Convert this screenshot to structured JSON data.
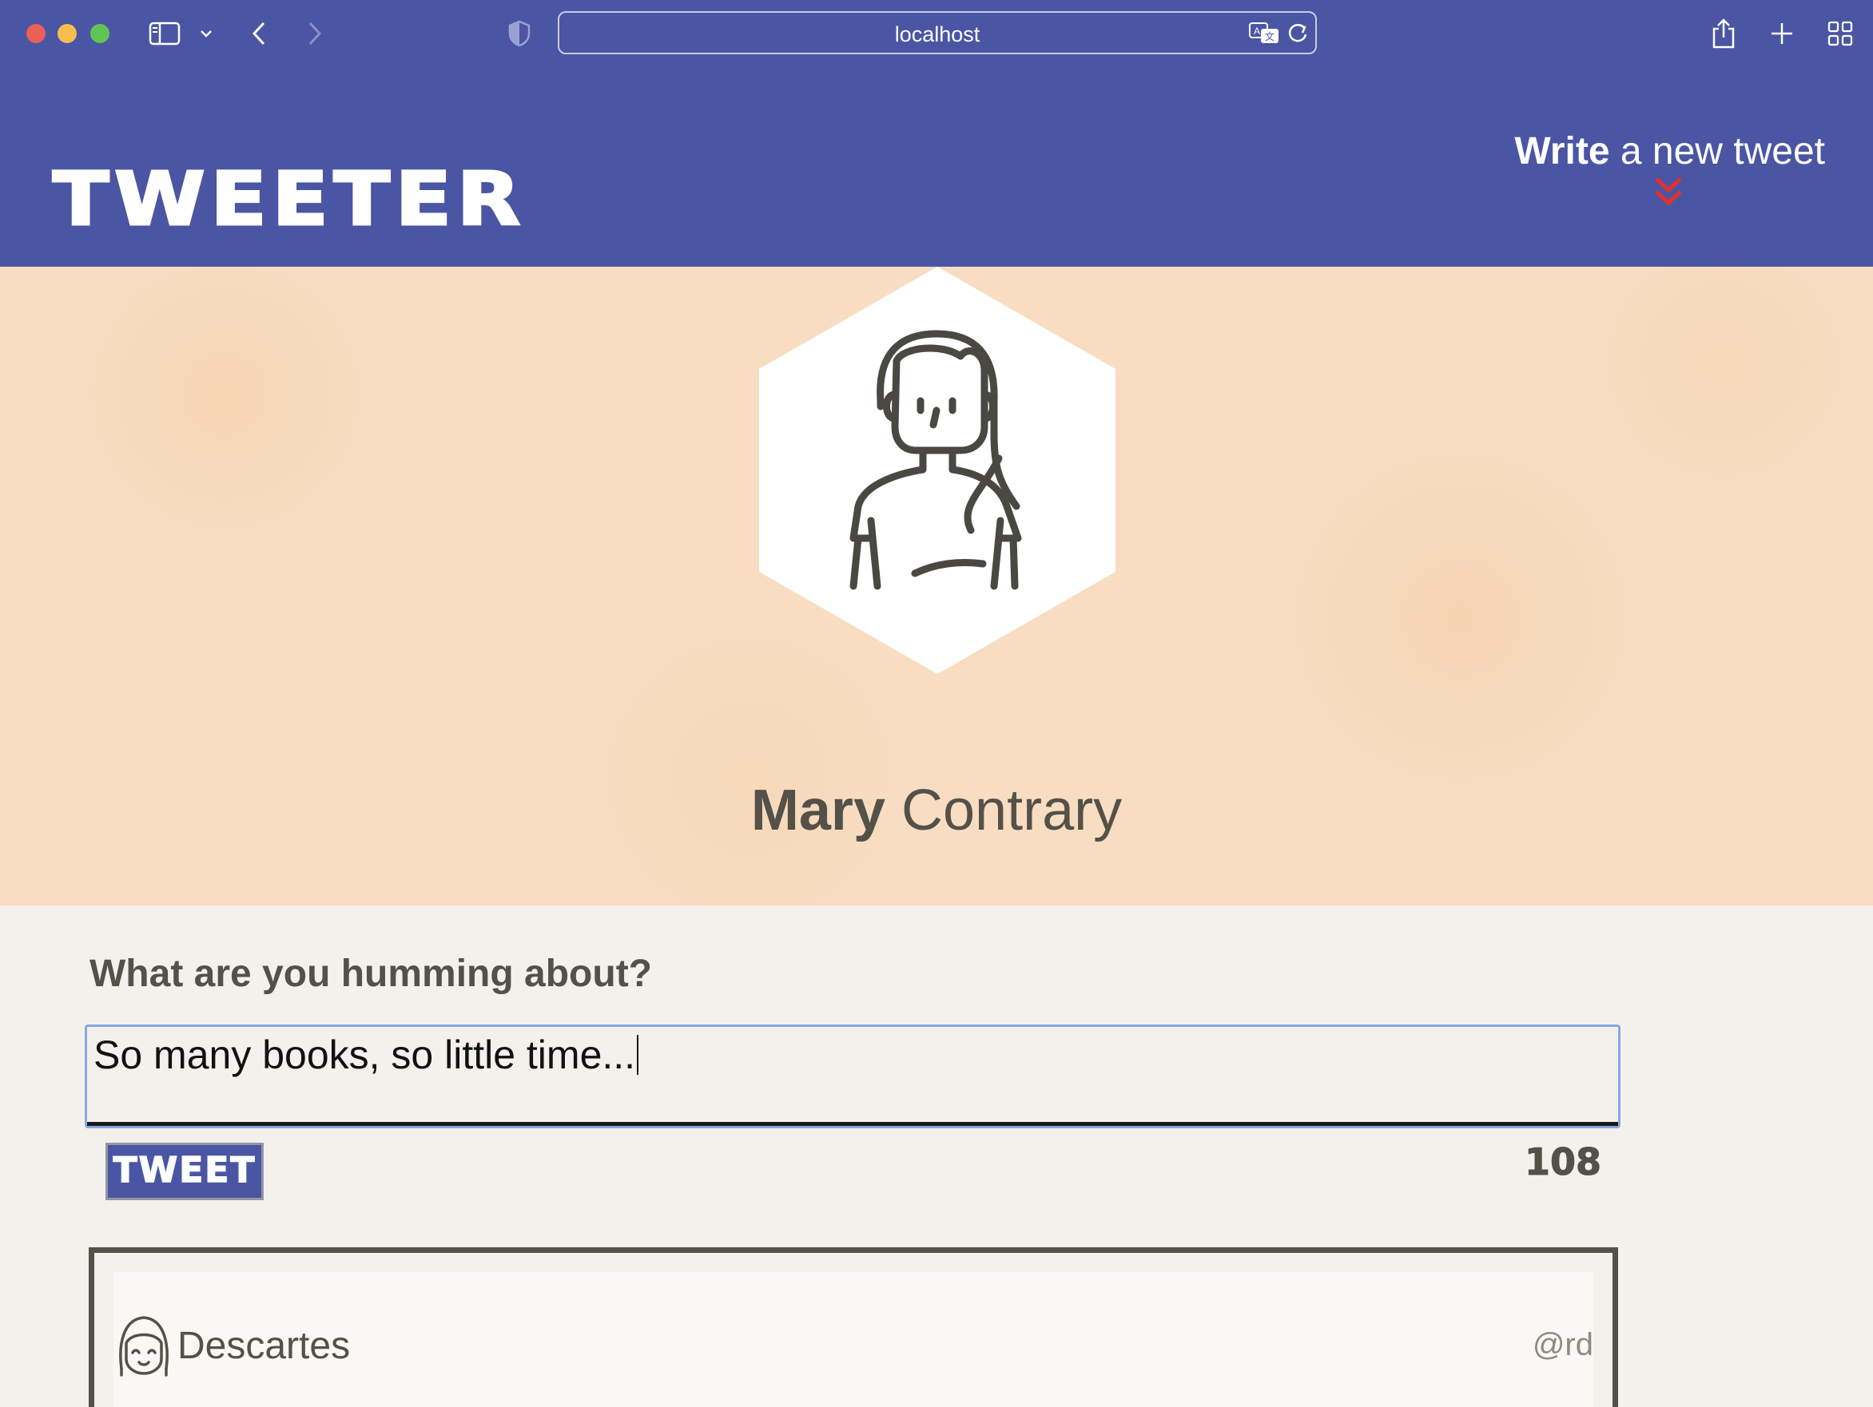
{
  "browser": {
    "address": "localhost",
    "colors": {
      "chrome": "#4a56a3"
    }
  },
  "header": {
    "logo": "TWEETER",
    "cta_strong": "Write",
    "cta_rest": " a new tweet",
    "cta_icon": "double-chevron-down-icon",
    "colors": {
      "background": "#4a56a3",
      "cta_arrow": "#e0322b"
    }
  },
  "profile": {
    "first_name": "Mary",
    "last_name": " Contrary",
    "avatar_icon": "woman-avatar-icon"
  },
  "compose": {
    "prompt": "What are you humming about?",
    "value": "So many books, so little time...",
    "button_label": "TWEET",
    "counter": "108"
  },
  "tweets": [
    {
      "author": "Descartes",
      "handle": "@rd",
      "avatar_icon": "face-avatar-icon"
    }
  ]
}
